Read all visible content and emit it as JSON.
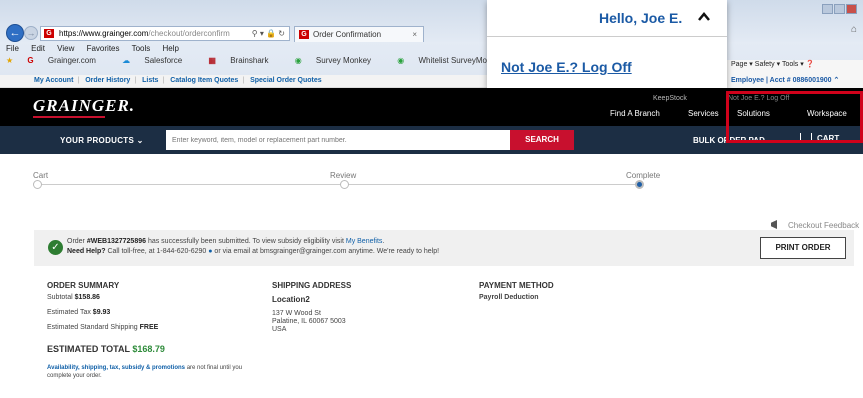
{
  "browser": {
    "url_domain": "https://www.grainger.com",
    "url_path": "/checkout/orderconfirm",
    "tab_title": "Order Confirmation",
    "menu": [
      "File",
      "Edit",
      "View",
      "Favorites",
      "Tools",
      "Help"
    ],
    "favorites": [
      "Grainger.com",
      "Salesforce",
      "Brainshark",
      "Survey Monkey",
      "Whitelist SurveyMonkey"
    ],
    "toolbar": [
      "Page",
      "Safety",
      "Tools"
    ]
  },
  "utility_links": [
    "My Account",
    "Order History",
    "Lists",
    "Catalog Item Quotes",
    "Special Order Quotes"
  ],
  "account_strip": {
    "role": "Employee",
    "acct": "Acct # 0886001900"
  },
  "header": {
    "logo": "GRAINGER.",
    "keepstock": "KeepStock",
    "find_branch": "Find A Branch",
    "services": "Services",
    "solutions": "Solutions",
    "workspace": "Workspace"
  },
  "search": {
    "products_label": "YOUR PRODUCTS",
    "placeholder": "Enter keyword, item, model or replacement part number.",
    "button": "SEARCH",
    "bulk_order": "BULK ORDER PAD",
    "cart": "CART"
  },
  "progress": {
    "steps": [
      "Cart",
      "Review",
      "Complete"
    ],
    "current": 3
  },
  "feedback": "Checkout Feedback",
  "confirmation": {
    "msg1_pre": "Order ",
    "order_no": "#WEB1327725896",
    "msg1_mid": " has successfully been submitted. To view subsidy eligibility visit ",
    "benefits_link": "My Benefits",
    "msg1_end": ".",
    "need_help": "Need Help?",
    "msg2_mid": " Call toll-free, at 1-844-620-6290",
    "msg2_end": " or via email at bmsgrainger@grainger.com anytime. We're ready to help!",
    "print": "PRINT ORDER"
  },
  "order_summary": {
    "title": "ORDER SUMMARY",
    "subtotal_label": "Subtotal",
    "subtotal": "$158.86",
    "tax_label": "Estimated Tax",
    "tax": "$9.93",
    "shipping_label": "Estimated Standard Shipping",
    "shipping": "FREE",
    "total_label": "ESTIMATED TOTAL",
    "total": "$168.79",
    "avail_link": "Availability, shipping, tax, subsidy & promotions",
    "avail_text": " are not final until you complete your order."
  },
  "shipping_address": {
    "title": "SHIPPING ADDRESS",
    "location": "Location2",
    "line1": "137 W Wood St",
    "line2": "Palatine, IL 60067 5003",
    "line3": "USA"
  },
  "payment": {
    "title": "PAYMENT METHOD",
    "method": "Payroll Deduction"
  },
  "popup": {
    "hello": "Hello, Joe E.",
    "logoff": "Not Joe E.? Log Off"
  },
  "highlight_text": "Not Joe E.? Log Off"
}
